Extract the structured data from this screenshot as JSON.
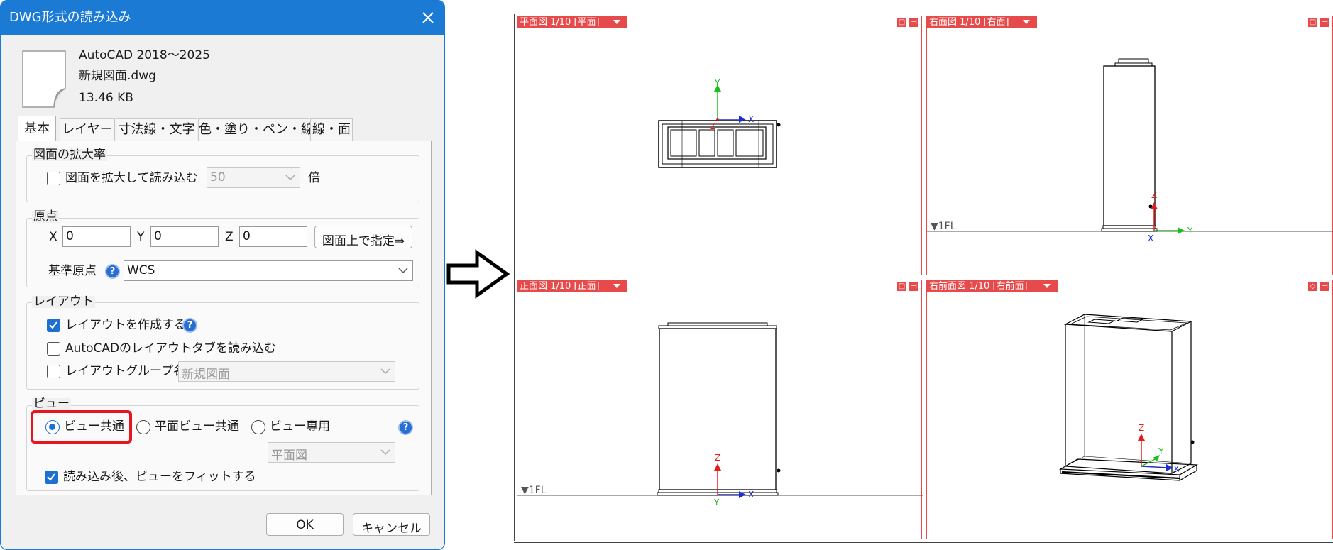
{
  "dialog": {
    "title": "DWG形式の読み込み",
    "file": {
      "version": "AutoCAD 2018〜2025",
      "name": "新規図面.dwg",
      "size": "13.46 KB"
    },
    "tabs": [
      "基本",
      "レイヤー",
      "寸法線・文字",
      "色・塗り・ペン・線種",
      "線・面"
    ],
    "scale": {
      "legend": "図面の拡大率",
      "checkbox_label": "図面を拡大して読み込む",
      "value": "50",
      "unit": "倍"
    },
    "origin": {
      "legend": "原点",
      "x_label": "X",
      "x_value": "0",
      "y_label": "Y",
      "y_value": "0",
      "z_label": "Z",
      "z_value": "0",
      "pick_button": "図面上で指定⇒",
      "base_label": "基準原点",
      "base_value": "WCS"
    },
    "layout": {
      "legend": "レイアウト",
      "create_label": "レイアウトを作成する",
      "read_tabs_label": "AutoCADのレイアウトタブを読み込む",
      "group_label": "レイアウトグループ名",
      "group_value": "新規図面"
    },
    "view": {
      "legend": "ビュー",
      "option_common": "ビュー共通",
      "option_plan_common": "平面ビュー共通",
      "option_dedicated": "ビュー専用",
      "dedicated_select": "平面図",
      "fit_label": "読み込み後、ビューをフィットする"
    },
    "buttons": {
      "ok": "OK",
      "cancel": "キャンセル"
    },
    "help_mark": "?",
    "highlight_color": "#e8141e"
  },
  "viewports": {
    "plan": {
      "title": "平面図 1/10 [平面]"
    },
    "right": {
      "title": "右面図 1/10 [右面]",
      "floor_label": "▼1FL"
    },
    "front": {
      "title": "正面図 1/10 [正面]",
      "floor_label": "▼1FL"
    },
    "perspective": {
      "title": "右前面図 1/10 [右前面]"
    }
  },
  "axis_labels": {
    "x": "X",
    "y": "Y",
    "z": "Z"
  },
  "colors": {
    "viewport_accent": "#e64a4a",
    "titlebar": "#1a7ad4",
    "checkbox_accent": "#1e6fd2",
    "axis_x": "#1e2fd0",
    "axis_y": "#1bbf1b",
    "axis_z": "#e01e1e"
  }
}
